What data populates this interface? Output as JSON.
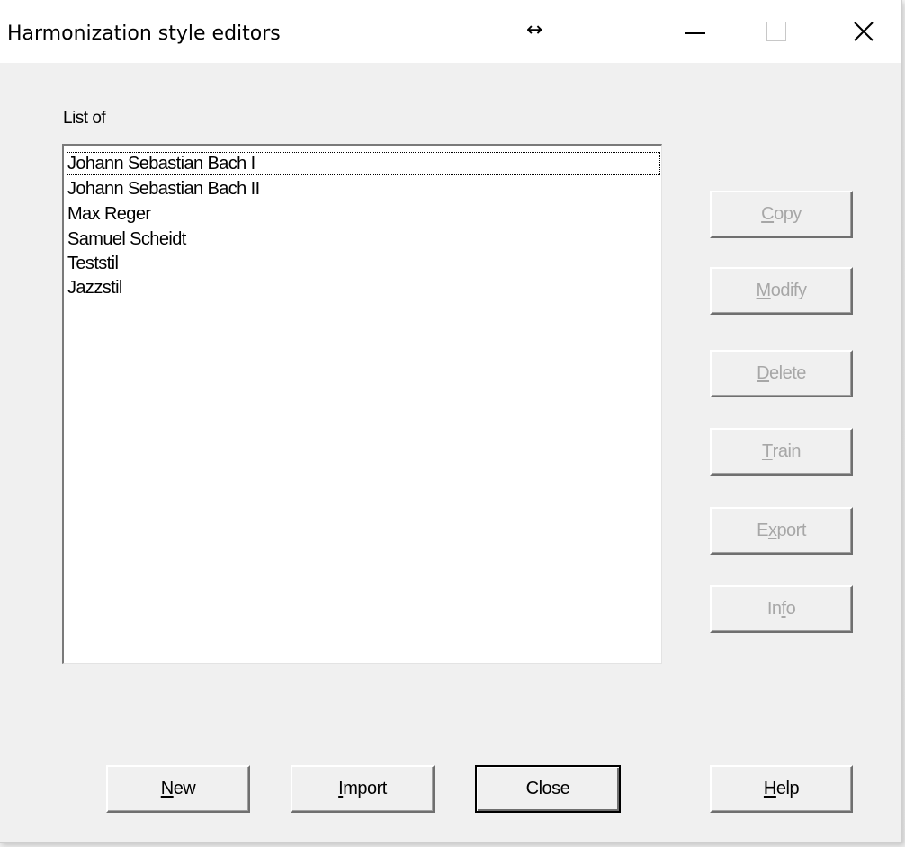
{
  "window": {
    "title": "Harmonization style editors",
    "resize_glyph": "↔",
    "controls": {
      "minimize": "minimize-icon",
      "maximize": "maximize-icon",
      "close": "close-icon",
      "close_glyph": "✕"
    }
  },
  "list_label": "List of",
  "list_items": [
    "Johann Sebastian Bach I",
    "Johann Sebastian Bach II",
    "Max Reger",
    "Samuel Scheidt",
    "Teststil",
    "Jazzstil"
  ],
  "side_buttons": {
    "copy": {
      "pre": "",
      "ul": "C",
      "post": "opy",
      "enabled": false
    },
    "modify": {
      "pre": "",
      "ul": "M",
      "post": "odify",
      "enabled": false
    },
    "delete": {
      "pre": "",
      "ul": "D",
      "post": "elete",
      "enabled": false
    },
    "train": {
      "pre": "",
      "ul": "T",
      "post": "rain",
      "enabled": false
    },
    "export": {
      "pre": "E",
      "ul": "x",
      "post": "port",
      "enabled": false
    },
    "info": {
      "pre": "In",
      "ul": "f",
      "post": "o",
      "enabled": false
    }
  },
  "bottom_buttons": {
    "new": {
      "pre": "",
      "ul": "N",
      "post": "ew"
    },
    "import": {
      "pre": "",
      "ul": "I",
      "post": "mport"
    },
    "close": {
      "label": "Close"
    },
    "help": {
      "pre": "",
      "ul": "H",
      "post": "elp"
    }
  },
  "colors": {
    "face": "#f0f0f0",
    "disabled_text": "#a7a7a7",
    "titlebar": "#ffffff"
  }
}
